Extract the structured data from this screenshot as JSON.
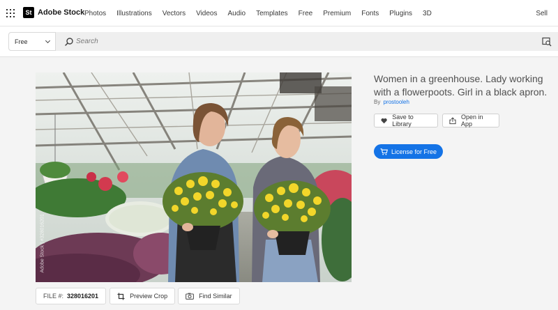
{
  "nav": {
    "brand": "Adobe Stock",
    "brand_badge": "St",
    "links": [
      "Photos",
      "Illustrations",
      "Vectors",
      "Videos",
      "Audio",
      "Templates",
      "Free",
      "Premium",
      "Fonts",
      "Plugins",
      "3D"
    ],
    "sell": "Sell"
  },
  "search": {
    "filter_value": "Free",
    "placeholder": "Search"
  },
  "photo": {
    "watermark": "Adobe Stock | #328016201"
  },
  "asset": {
    "title": "Women in a greenhouse. Lady working with a flowerpoots. Girl in a black apron.",
    "by_label": "By",
    "author": "prostooleh",
    "save_label": "Save to Library",
    "open_label": "Open in App",
    "license_label": "License for Free",
    "file_label": "FILE #:",
    "file_number": "328016201",
    "preview_crop_label": "Preview Crop",
    "find_similar_label": "Find Similar"
  },
  "colors": {
    "accent": "#1473e6",
    "link": "#1473e6"
  },
  "icons": {
    "app_switcher": "grid-icon",
    "search": "search-icon",
    "visual_search": "visual-search-icon",
    "save": "heart-icon",
    "open": "share-icon",
    "license": "cart-icon",
    "crop": "crop-icon",
    "similar": "camera-icon"
  }
}
